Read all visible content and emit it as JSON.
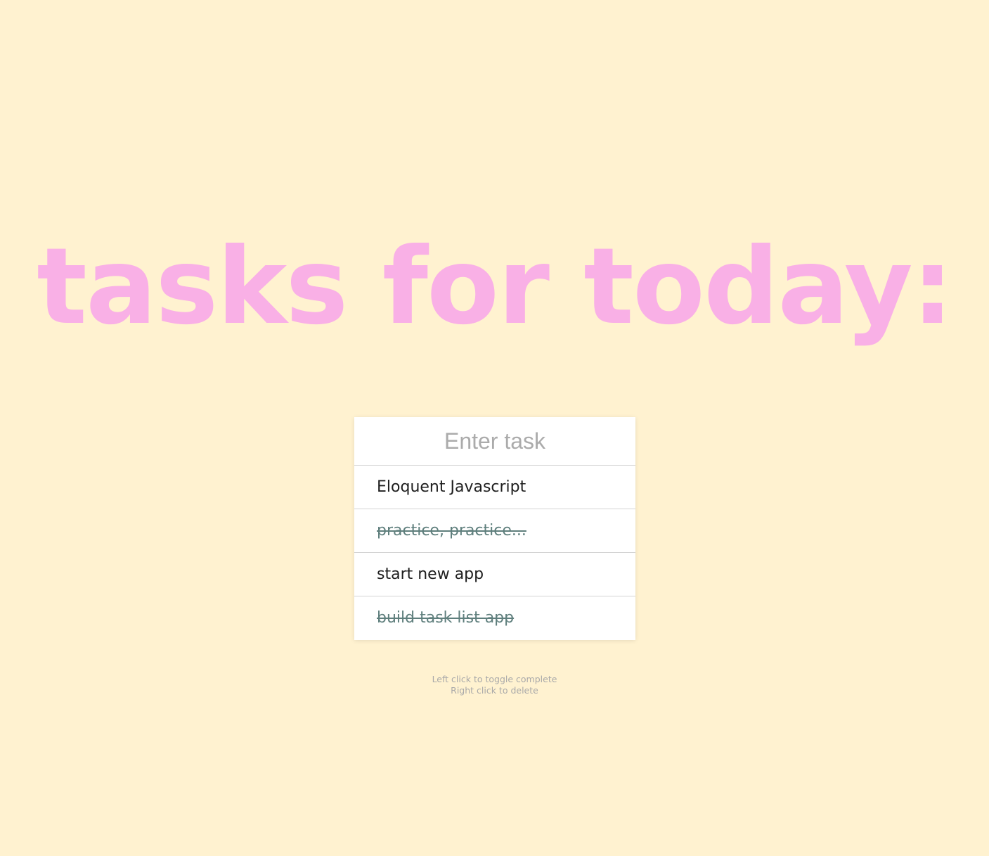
{
  "colors": {
    "background": "#fff2d0",
    "title": "#f9b0e6",
    "completed_task": "#5f7f7d",
    "hint": "#a9a9a9"
  },
  "title": "tasks for today:",
  "input": {
    "placeholder": "Enter task",
    "value": ""
  },
  "tasks": [
    {
      "label": "Eloquent Javascript",
      "completed": false
    },
    {
      "label": "practice, practice...",
      "completed": true
    },
    {
      "label": "start new app",
      "completed": false
    },
    {
      "label": "build task list app",
      "completed": true
    }
  ],
  "hints": {
    "line1": "Left click to toggle complete",
    "line2": "Right click to delete"
  }
}
